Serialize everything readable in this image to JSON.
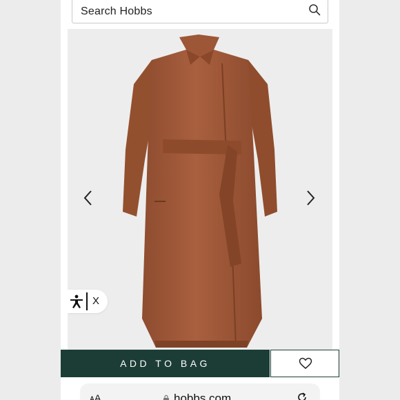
{
  "search": {
    "placeholder": "Search Hobbs",
    "icon": "search-icon"
  },
  "product": {
    "image_alt": "Brown wool belted wrap coat",
    "prev_icon": "chevron-left-icon",
    "next_icon": "chevron-right-icon"
  },
  "accessibility": {
    "icon": "accessibility-icon",
    "close_label": "X"
  },
  "actions": {
    "add_to_bag_label": "ADD TO BAG",
    "wishlist_icon": "heart-icon"
  },
  "browser": {
    "text_size_label": "ᴀA",
    "url": "hobbs.com"
  },
  "colors": {
    "primary": "#1c3d36",
    "coat": "#a55c3b",
    "background": "#ededed"
  }
}
